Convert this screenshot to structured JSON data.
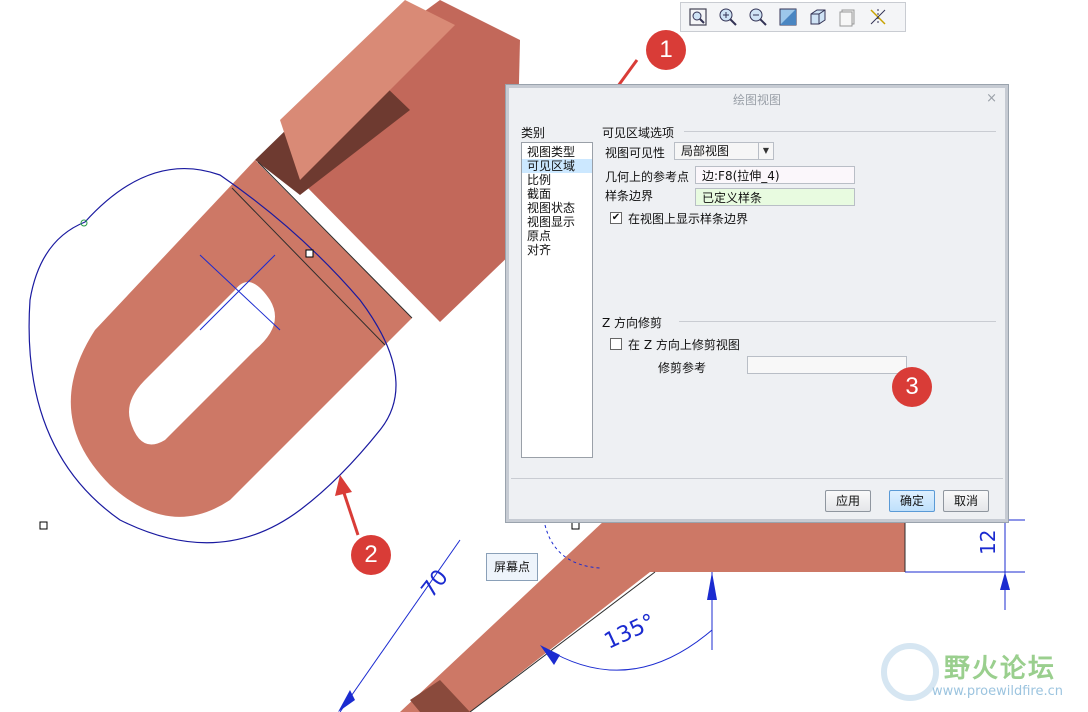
{
  "toolbar": {
    "icons": [
      "zoom-fit-icon",
      "zoom-in-icon",
      "zoom-out-icon",
      "reorient-icon",
      "view-cube-icon",
      "saved-views-icon",
      "display-style-icon"
    ]
  },
  "dialog": {
    "title": "绘图视图",
    "close_symbol": "×",
    "categories_label": "类别",
    "categories": [
      "视图类型",
      "可见区域",
      "比例",
      "截面",
      "视图状态",
      "视图显示",
      "原点",
      "对齐"
    ],
    "selected_category": "可见区域",
    "visible_area_section": "可见区域选项",
    "view_visibility_label": "视图可见性",
    "view_visibility_value": "局部视图",
    "ref_point_label": "几何上的参考点",
    "ref_point_value": "边:F8(拉伸_4)",
    "spline_boundary_label": "样条边界",
    "spline_boundary_value": "已定义样条",
    "show_spline_label": "在视图上显示样条边界",
    "show_spline_checked": true,
    "z_trim_section": "Z 方向修剪",
    "z_trim_label": "在 Z 方向上修剪视图",
    "z_trim_checked": false,
    "trim_ref_label": "修剪参考",
    "trim_ref_value": "",
    "apply_button": "应用",
    "ok_button": "确定",
    "cancel_button": "取消"
  },
  "tooltip": {
    "text": "屏幕点"
  },
  "drawing": {
    "dim_length": "70",
    "dim_angle": "135°",
    "dim_height": "12"
  },
  "callouts": [
    "1",
    "2",
    "3"
  ],
  "watermark": {
    "text": "野火论坛",
    "url": "www.proewildfire.cn"
  },
  "colors": {
    "part": "#cd7866",
    "part_dark": "#b8604f",
    "spline": "#1a1aa0",
    "dim": "#1b2bd0",
    "arrow": "#d93c37"
  }
}
